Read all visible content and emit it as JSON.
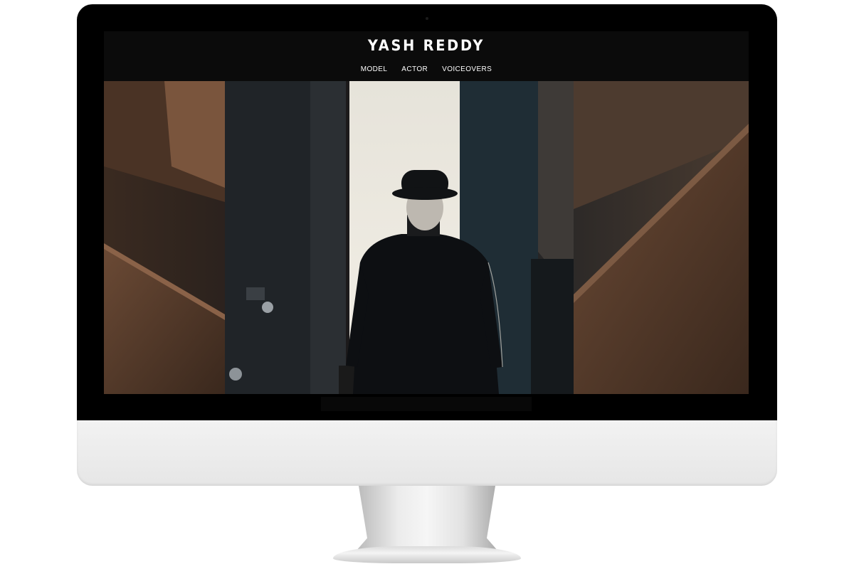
{
  "site": {
    "title": "YASH REDDY",
    "nav": [
      {
        "label": "MODEL"
      },
      {
        "label": "ACTOR"
      },
      {
        "label": "VOICEOVERS"
      }
    ]
  },
  "hero": {
    "media": "video-still"
  },
  "colors": {
    "header_bg": "#0b0b0b",
    "text": "#ffffff",
    "monitor_bezel": "#000000",
    "monitor_chin": "#eeeeee"
  }
}
